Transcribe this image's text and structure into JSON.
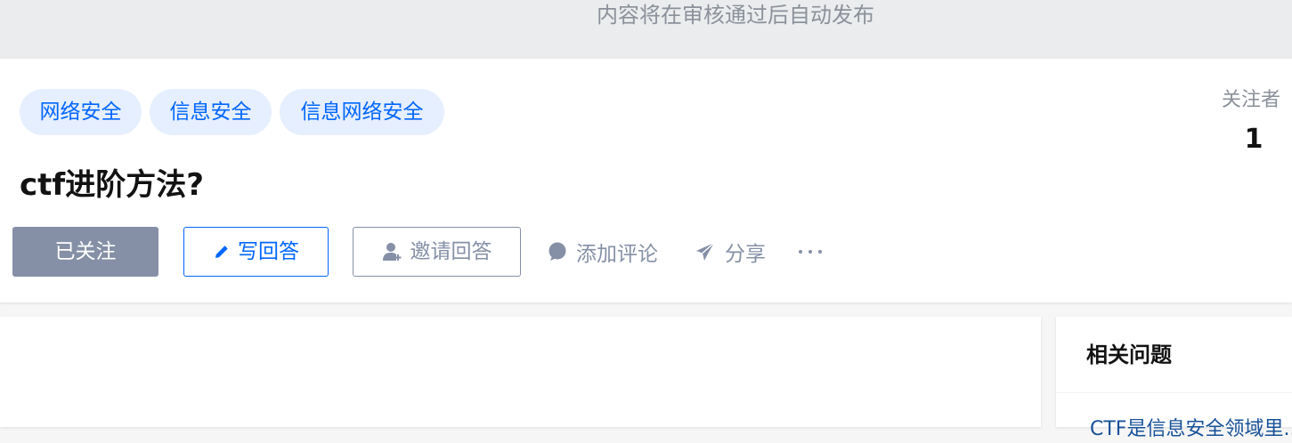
{
  "banner": {
    "text": "内容将在审核通过后自动发布"
  },
  "question": {
    "topics": [
      "网络安全",
      "信息安全",
      "信息网络安全"
    ],
    "title": "ctf进阶方法?",
    "followers_label": "关注者",
    "followers_count": "1"
  },
  "actions": {
    "followed_label": "已关注",
    "write_answer_label": "写回答",
    "invite_label": "邀请回答",
    "comment_label": "添加评论",
    "share_label": "分享",
    "more_label": "···"
  },
  "sidebar": {
    "title": "相关问题",
    "first_item_partial": "CTF是信息安全领域里..."
  },
  "icons": {
    "write": "pencil-icon",
    "invite": "add-user-icon",
    "comment": "comment-bubble-icon",
    "share": "paper-plane-icon",
    "more": "more-dots-icon"
  },
  "colors": {
    "brand_blue": "#0066ff",
    "tag_bg": "#e5efff",
    "muted": "#8590a6",
    "followed_bg": "#8590a6",
    "banner_bg": "#ebecee"
  }
}
